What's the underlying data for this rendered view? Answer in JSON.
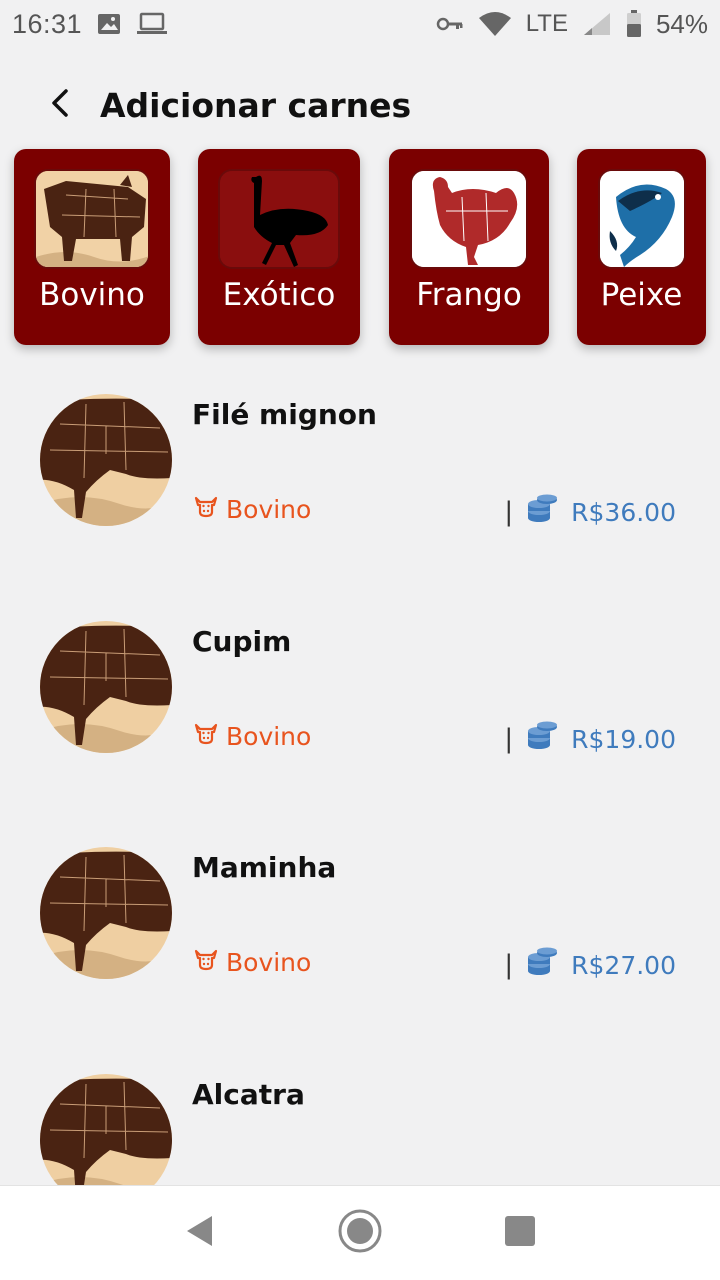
{
  "status_bar": {
    "time": "16:31",
    "network": "LTE",
    "battery": "54%",
    "icons": [
      "image-icon",
      "laptop-icon",
      "key-icon",
      "wifi-icon",
      "signal-icon",
      "battery-icon"
    ]
  },
  "header": {
    "title": "Adicionar carnes",
    "back_icon": "back-arrow-icon"
  },
  "categories": [
    {
      "label": "Bovino",
      "icon": "beef-cuts-image"
    },
    {
      "label": "Exótico",
      "icon": "ostrich-image"
    },
    {
      "label": "Frango",
      "icon": "chicken-cuts-image"
    },
    {
      "label": "Peixe",
      "icon": "fish-image"
    }
  ],
  "products": [
    {
      "name": "Filé mignon",
      "category": "Bovino",
      "price": "R$36.00"
    },
    {
      "name": "Cupim",
      "category": "Bovino",
      "price": "R$19.00"
    },
    {
      "name": "Maminha",
      "category": "Bovino",
      "price": "R$27.00"
    },
    {
      "name": "Alcatra",
      "category": "",
      "price": ""
    }
  ],
  "colors": {
    "accent": "#7b0000",
    "category_text": "#e8541e",
    "price_text": "#3f7bbd",
    "background": "#f1f1f2"
  },
  "nav_bar": {
    "icons": [
      "back-triangle-icon",
      "home-circle-icon",
      "recents-square-icon"
    ]
  }
}
